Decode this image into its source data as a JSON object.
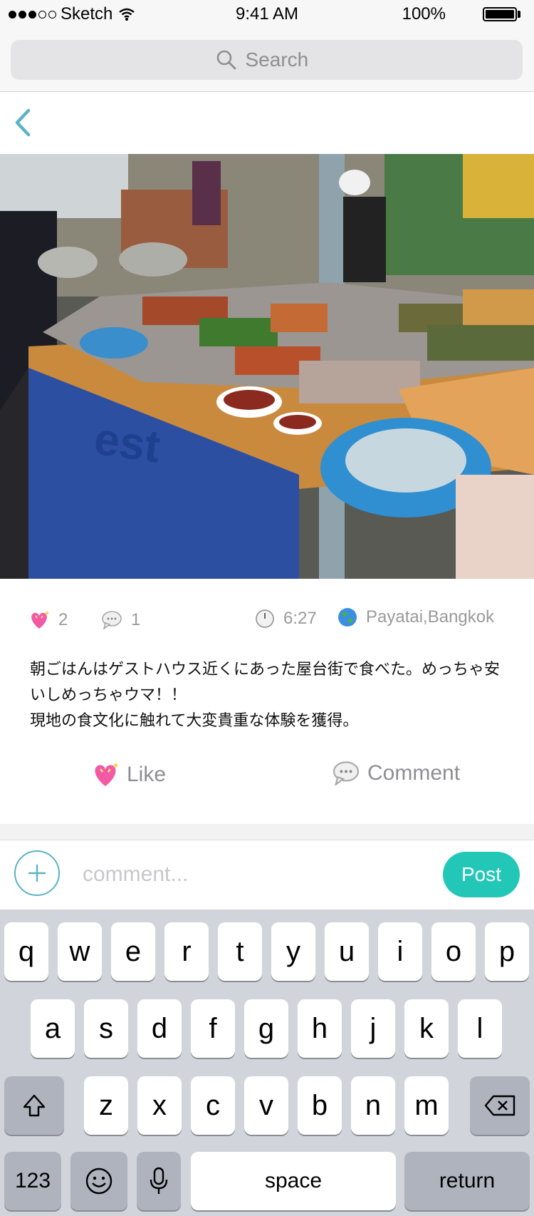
{
  "status_bar": {
    "carrier": "Sketch",
    "time": "9:41 AM",
    "battery": "100%"
  },
  "search": {
    "placeholder": "Search"
  },
  "post": {
    "likes": "2",
    "comments": "1",
    "time": "6:27",
    "location": "Payatai,Bangkok",
    "text": "朝ごはんはゲストハウス近くにあった屋台街で食べた。めっちゃ安いしめっちゃウマ！！\n現地の食文化に触れて大変貴重な体験を獲得。"
  },
  "actions": {
    "like_label": "Like",
    "comment_label": "Comment"
  },
  "comment_bar": {
    "placeholder": "comment...",
    "post_label": "Post"
  },
  "keyboard": {
    "row1": [
      "q",
      "w",
      "e",
      "r",
      "t",
      "y",
      "u",
      "i",
      "o",
      "p"
    ],
    "row2": [
      "a",
      "s",
      "d",
      "f",
      "g",
      "h",
      "j",
      "k",
      "l"
    ],
    "row3": [
      "z",
      "x",
      "c",
      "v",
      "b",
      "n",
      "m"
    ],
    "numbers_label": "123",
    "space_label": "space",
    "return_label": "return"
  },
  "colors": {
    "accent": "#22c7b8",
    "back_arrow": "#5bb3c3"
  }
}
